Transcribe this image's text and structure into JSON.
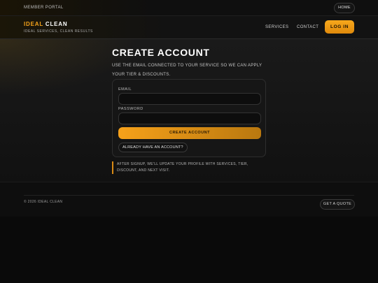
{
  "topbar": {
    "portal_label": "MEMBER PORTAL",
    "home_label": "HOME"
  },
  "header": {
    "brand_accent": "IDEAL",
    "brand_rest": "CLEAN",
    "tagline": "IDEAL SERVICES, CLEAN RESULTS",
    "nav": {
      "services": "SERVICES",
      "contact": "CONTACT"
    },
    "login_label": "LOG IN"
  },
  "main": {
    "title": "CREATE ACCOUNT",
    "subtitle": "USE THE EMAIL CONNECTED TO YOUR SERVICE SO WE CAN APPLY YOUR TIER & DISCOUNTS.",
    "form": {
      "email_label": "EMAIL",
      "email_value": "",
      "password_label": "PASSWORD",
      "password_value": "",
      "submit_label": "CREATE ACCOUNT",
      "have_account_label": "ALREADY HAVE AN ACCOUNT?"
    },
    "note_line1": "AFTER SIGNUP, WE'LL UPDATE YOUR PROFILE WITH SERVICES, TIER,",
    "note_line2": "DISCOUNT, AND NEXT VISIT."
  },
  "footer": {
    "copyright": "© 2026 IDEAL CLEAN",
    "quote_label": "GET A QUOTE"
  },
  "colors": {
    "accent": "#f5a31a",
    "background": "#0b0b0b",
    "card": "#161616"
  }
}
